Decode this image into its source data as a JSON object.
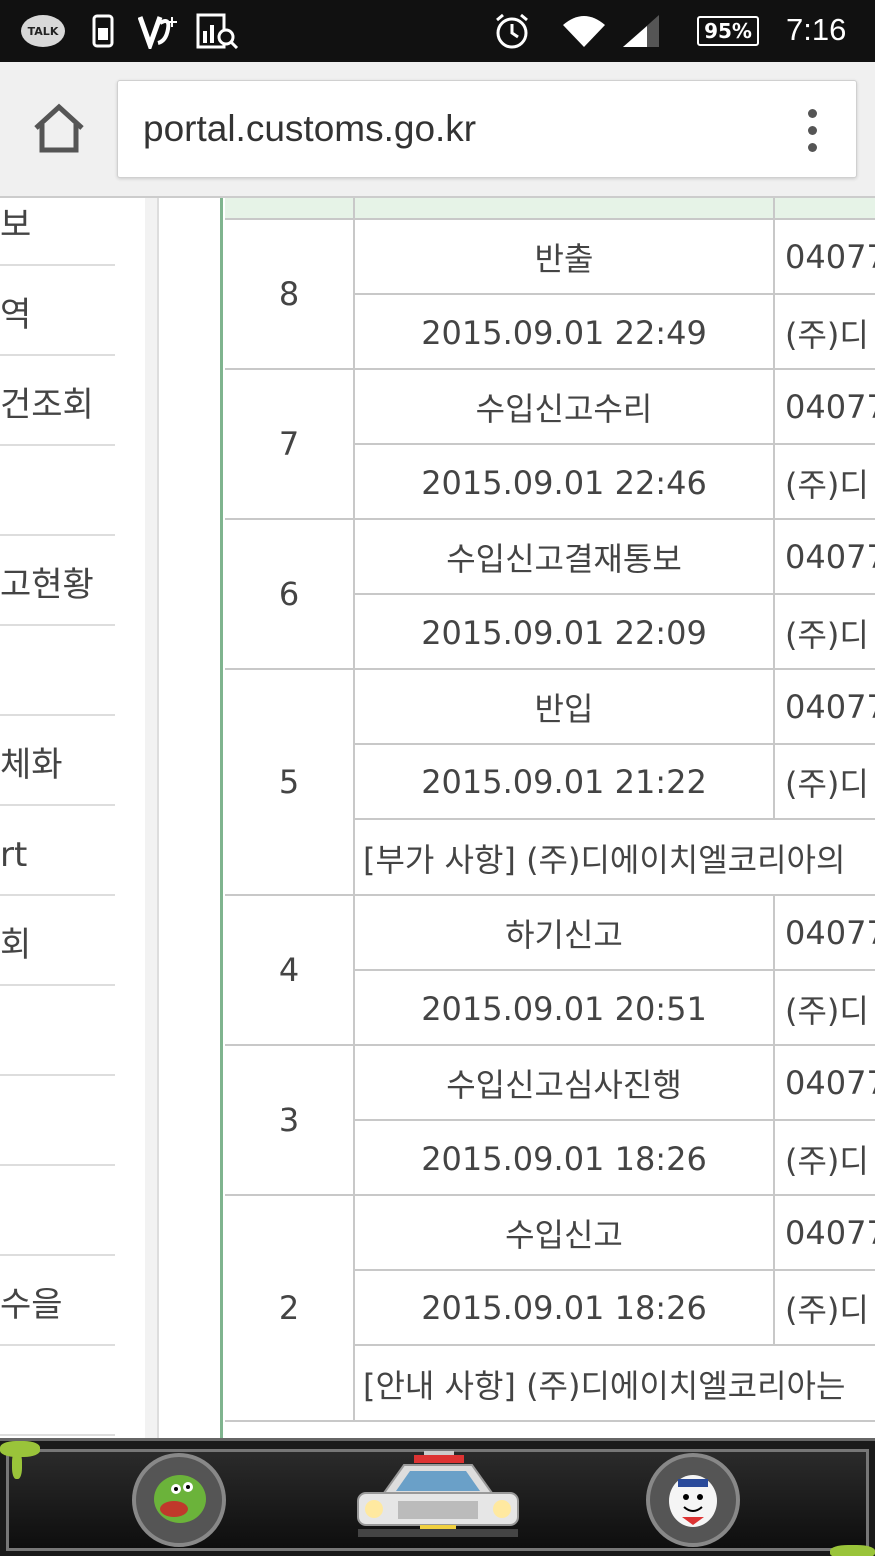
{
  "status_bar": {
    "talk_label": "TALK",
    "battery": "95%",
    "time": "7:16",
    "icons": [
      "kakaotalk-icon",
      "sim-icon",
      "v3-plus-icon",
      "chart-search-icon",
      "alarm-icon",
      "wifi-icon",
      "signal-icon",
      "battery-icon"
    ]
  },
  "browser": {
    "url": "portal.customs.go.kr",
    "home_icon": "home-icon",
    "menu_icon": "overflow-menu-icon"
  },
  "sidebar": {
    "items": [
      "보",
      "역",
      "건조회",
      "",
      "고현황",
      "",
      "체화",
      "rt",
      "회",
      "",
      "",
      "",
      "수을",
      ""
    ]
  },
  "table": {
    "groups": [
      {
        "seq": "8",
        "rows": [
          {
            "main": "반출",
            "side": "04077"
          },
          {
            "main": "2015.09.01 22:49",
            "side": "(주)디"
          }
        ]
      },
      {
        "seq": "7",
        "rows": [
          {
            "main": "수입신고수리",
            "side": "04077"
          },
          {
            "main": "2015.09.01 22:46",
            "side": "(주)디"
          }
        ]
      },
      {
        "seq": "6",
        "rows": [
          {
            "main": "수입신고결재통보",
            "side": "04077"
          },
          {
            "main": "2015.09.01 22:09",
            "side": "(주)디"
          }
        ]
      },
      {
        "seq": "5",
        "rows": [
          {
            "main": "반입",
            "side": "04077"
          },
          {
            "main": "2015.09.01 21:22",
            "side": "(주)디"
          }
        ],
        "note": "[부가 사항] (주)디에이치엘코리아의"
      },
      {
        "seq": "4",
        "rows": [
          {
            "main": "하기신고",
            "side": "04077"
          },
          {
            "main": "2015.09.01 20:51",
            "side": "(주)디"
          }
        ]
      },
      {
        "seq": "3",
        "rows": [
          {
            "main": "수입신고심사진행",
            "side": "04077"
          },
          {
            "main": "2015.09.01 18:26",
            "side": "(주)디"
          }
        ]
      },
      {
        "seq": "2",
        "rows": [
          {
            "main": "수입신고",
            "side": "04077"
          },
          {
            "main": "2015.09.01 18:26",
            "side": "(주)디"
          }
        ],
        "note": "[안내 사항] (주)디에이치엘코리아는"
      }
    ]
  },
  "dock": {
    "apps": [
      "slimer-ghost-icon",
      "ecto-car-icon",
      "marshmallow-man-icon"
    ],
    "colors": {
      "slime": "#9ac43a",
      "frame": "#777777"
    }
  }
}
